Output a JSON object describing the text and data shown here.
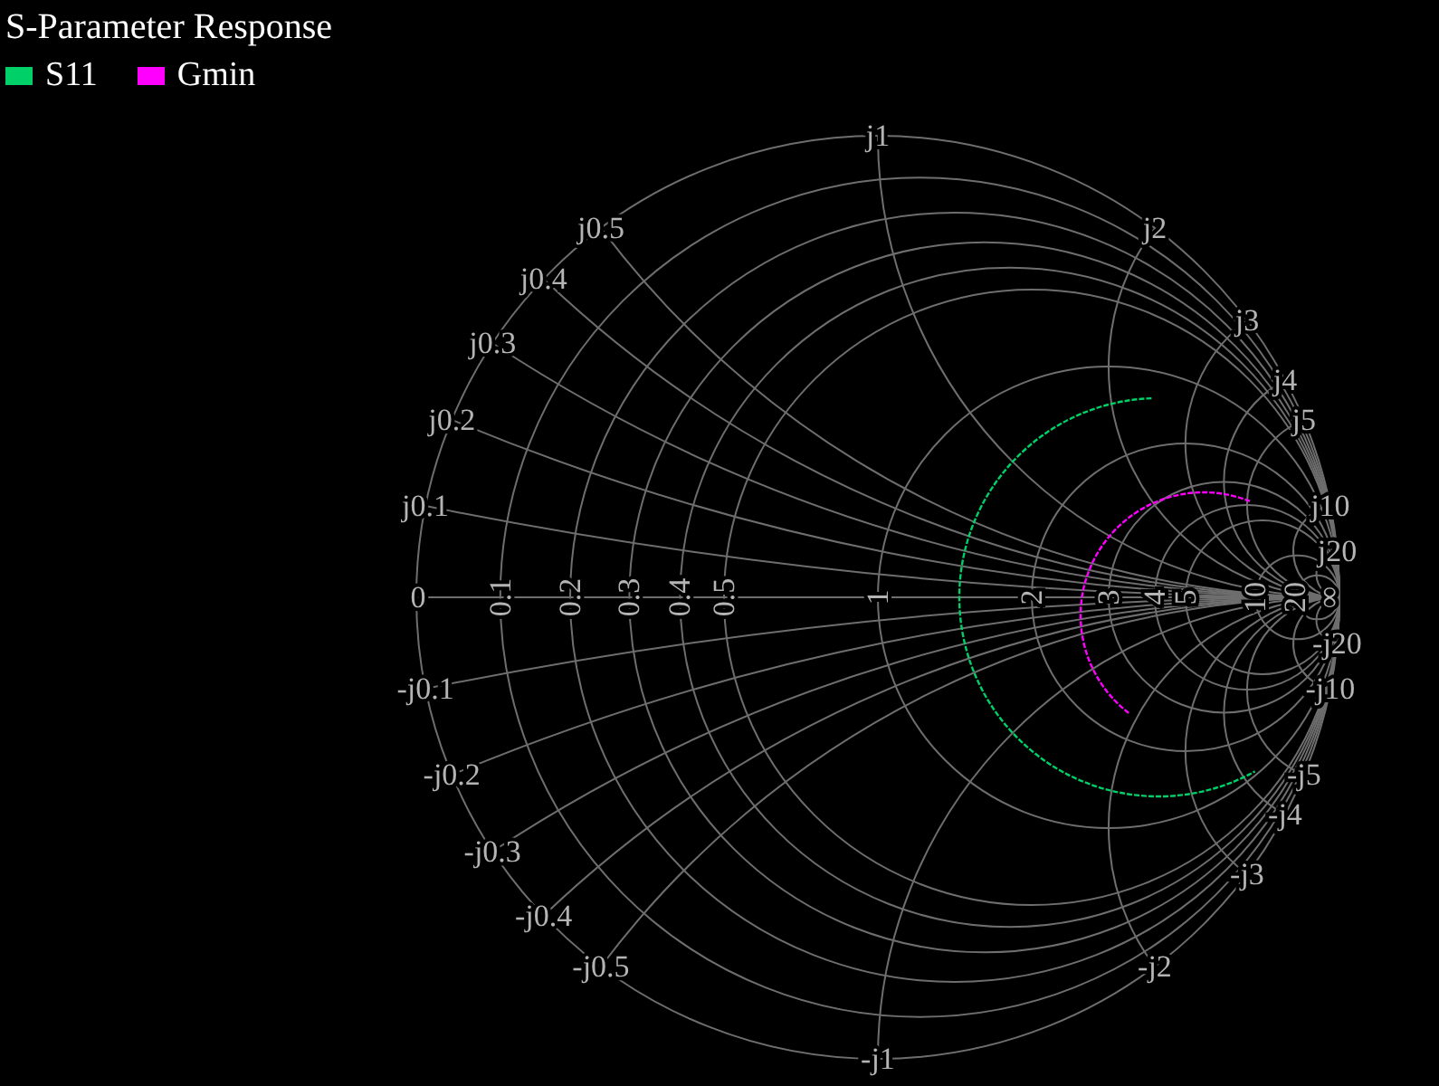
{
  "title": "S-Parameter Response",
  "legend": [
    {
      "label": "S11",
      "color": "#00d068"
    },
    {
      "label": "Gmin",
      "color": "#ff00ff"
    }
  ],
  "smith_chart": {
    "resistance_labels": [
      "0",
      "0.1",
      "0.2",
      "0.3",
      "0.4",
      "0.5",
      "1",
      "2",
      "3",
      "4",
      "5",
      "10",
      "20",
      "∞"
    ],
    "positive_reactance_labels": [
      "j0.1",
      "j0.2",
      "j0.3",
      "j0.4",
      "j0.5",
      "j1",
      "j2",
      "j3",
      "j4",
      "j5",
      "j10",
      "j20"
    ],
    "negative_reactance_labels": [
      "-j0.1",
      "-j0.2",
      "-j0.3",
      "-j0.4",
      "-j0.5",
      "-j1",
      "-j2",
      "-j3",
      "-j4",
      "-j5",
      "-j10",
      "-j20"
    ]
  }
}
